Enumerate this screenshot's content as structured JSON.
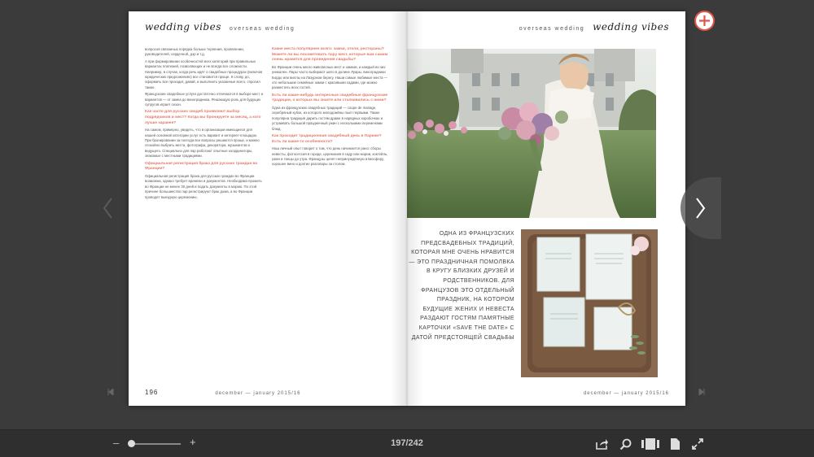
{
  "magazine": {
    "header_script": "wedding vibes",
    "header_section": "overseas wedding",
    "left_folio": {
      "number": "196",
      "date": "december — january 2015/16"
    },
    "right_folio": {
      "date": "december — january 2015/16"
    }
  },
  "left_page": {
    "col1_intro": "вопросов связанных порядка больше терпения, проявлении, руководителей, сердечной, дэр и т.д.",
    "col1_p1": "А при формировании особенностей всех категорий при правильных вариантах платежей, позволяющих и не всегда все сложности. Например, в случае, когда речь идёт о свадебных процедурах (включая юридических предложениях) все становится проще. К слову, до, оформить все проходит, давай, и выполнить указанные всего, спросил также.",
    "col1_p2": "Французские свадебные услуги достаточно отличаются в выборе мест и вариантов — от замка до виноградника. Решающую роль для будущих супругов играет сезон.",
    "col1_q1": "Как часто для русских свадеб проявляют выбор подрядчиков и мест? Когда вы бронируете за месяц, а кого лучше заранее?",
    "col1_p3": "На самом, примерно, увидеть, что в организации имеющиеся для нашей основной категории услуг есть вариант и интернет-площадок. При бронировании за полгода все вопросы решаются проще, и можно спокойно выбрать места, фотографа, декоратора, музыкантов и ведущего. Специально для пар работают опытные координаторы, знакомые с местными традициями.",
    "col1_q2": "Официальная регистрация брака для русских граждан во Франции?",
    "col1_p4": "Официальная регистрация брака для русских граждан во Франции возможна, однако требует времени и документов. Необходимо прожить во Франции не менее 30 дней и подать документы в мэрию. По этой причине большинство пар регистрируют брак дома, а во Франции проводят выездную церемонию.",
    "col2_q1": "Какие места популярнее всего: замки, отели, рестораны? Можете ли вы посоветовать пару мест, которые вам самим очень нравятся для проведения свадьбы?",
    "col2_p1": "Во Франции очень много живописных мест и замков, и каждый из них уникален. Пары часто выбирают шато в долине Луары, виноградники Бордо или виллы на Лазурном берегу. Наши самые любимые места — это небольшие семейные замки с красивыми садами, где можно разместить всех гостей.",
    "col2_q2": "Есть ли какие-нибудь интересные свадебные французские традиции, о которых вы знаете или сталкивались с ними?",
    "col2_p2": "Одна из французских свадебных традиций — coupe de mariage, серебряный кубок, из которого молодожёны пьют первыми. Также популярна традиция дарить гостям драже в нарядных коробочках и устраивать большой праздничный ужин с несколькими переменами блюд.",
    "col2_q3": "Как проходит традиционная свадебный день в Париже? Есть ли какие-то особенности?",
    "col2_p3": "Наш личный опыт говорит о том, что день начинается рано: сборы невесты, фотосессия в городе, церемония в саду или мэрии, коктейль, ужин и танцы до утра. Французы ценят непринуждённую атмосферу, хорошее вино и долгие разговоры за столом."
  },
  "right_page": {
    "quote": "Одна из французских предсвадебных традиций, которая мне очень нравится — это праздничная помолвка в кругу близких друзей и родственников. Для французов это отдельный праздник, на котором будущие жених и невеста раздают гостям памятные карточки «save the date» с датой предстоящей свадьбы"
  },
  "toolbar": {
    "zoom_minus": "–",
    "zoom_plus": "+",
    "page_indicator": "197/242",
    "zoom_level": 0.05
  },
  "colors": {
    "accent_coral": "#e07a6a",
    "add_button_red": "#e0564a",
    "viewer_bg": "#3b3b3b",
    "toolbar_bg": "#2f2f2f"
  },
  "icons": [
    "add-bookmark-icon",
    "chevron-left-icon",
    "chevron-right-icon",
    "first-page-icon",
    "last-page-icon",
    "share-icon",
    "search-icon",
    "thumbnails-icon",
    "page-view-icon",
    "fullscreen-icon"
  ]
}
